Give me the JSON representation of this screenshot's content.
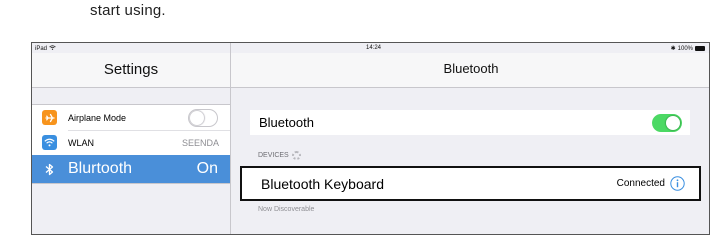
{
  "document": {
    "text": "start using."
  },
  "status_bar": {
    "device": "iPad",
    "time": "14:24",
    "battery": "100%"
  },
  "sidebar": {
    "title": "Settings",
    "items": [
      {
        "label": "Airplane Mode",
        "value": "",
        "icon": "airplane-icon",
        "icon_color": "#f7941d",
        "toggle": "off"
      },
      {
        "label": "WLAN",
        "value": "SEENDA",
        "icon": "wifi-icon",
        "icon_color": "#3a8fe0"
      },
      {
        "label": "Blurtooth",
        "value": "On",
        "icon": "bluetooth-icon",
        "selected": true
      }
    ]
  },
  "detail": {
    "title": "Bluetooth",
    "bluetooth_row": {
      "label": "Bluetooth",
      "toggle": "on"
    },
    "devices_header": "DEVICES",
    "device": {
      "name": "Bluetooth Keyboard",
      "status": "Connected"
    },
    "footer": "Now Discoverable"
  },
  "colors": {
    "selection": "#4a8fd9",
    "toggle_on": "#4cd964",
    "info": "#3a8fe0"
  }
}
